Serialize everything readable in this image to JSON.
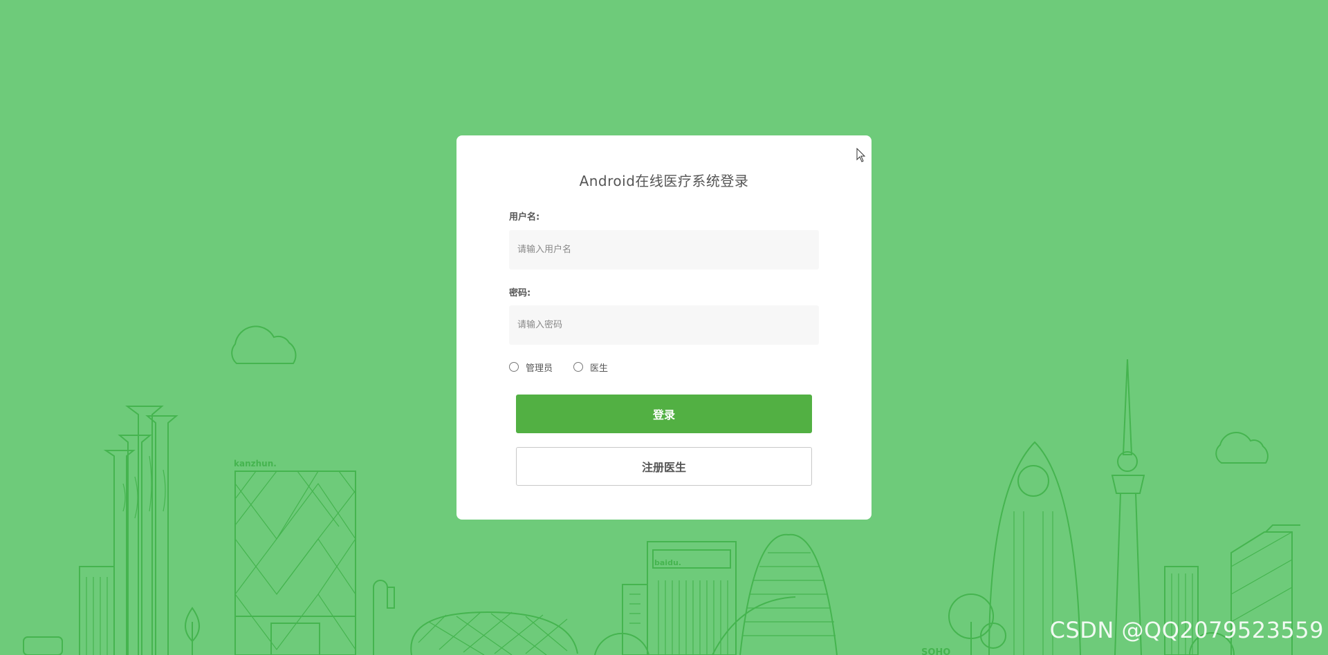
{
  "login": {
    "title": "Android在线医疗系统登录",
    "username_label": "用户名:",
    "username_placeholder": "请输入用户名",
    "username_value": "",
    "password_label": "密码:",
    "password_placeholder": "请输入密码",
    "password_value": "",
    "roles": [
      {
        "label": "管理员",
        "selected": false
      },
      {
        "label": "医生",
        "selected": false
      }
    ],
    "login_button": "登录",
    "register_button": "注册医生"
  },
  "background": {
    "color": "#6ecb7a",
    "line_color": "#45b44f",
    "building_labels": [
      "kanzhun.",
      "baidu.",
      "SOHO"
    ]
  },
  "theme": {
    "primary": "#52b043",
    "card": "#ffffff",
    "input_bg": "#f7f7f7"
  },
  "watermark": "CSDN @QQ2079523559"
}
